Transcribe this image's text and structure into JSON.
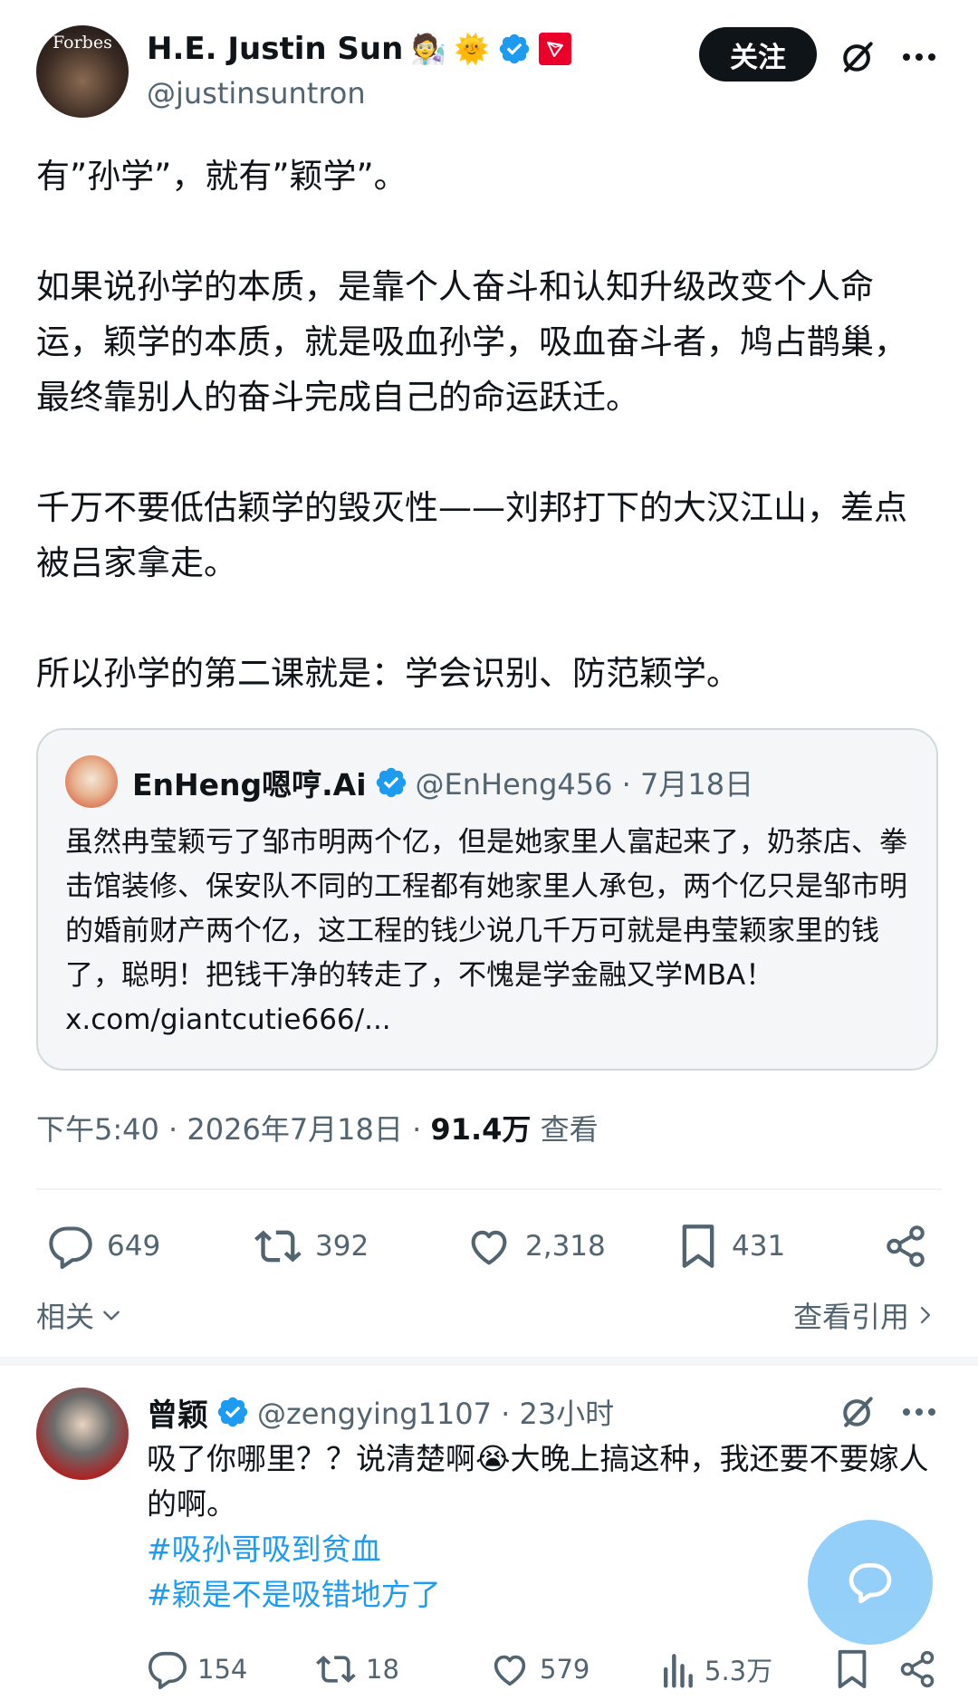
{
  "tweet": {
    "author_name": "H.E. Justin Sun",
    "author_handle": "@justinsuntron",
    "avatar_logo_text": "Forbes",
    "badge_emojis": [
      "🧑‍🔬",
      "🌞"
    ],
    "follow_label": "关注",
    "paragraphs": [
      "有”孙学”，就有”颖学”。",
      "如果说孙学的本质，是靠个人奋斗和认知升级改变个人命运，颖学的本质，就是吸血孙学，吸血奋斗者，鸠占鹊巢，最终靠别人的奋斗完成自己的命运跃迁。",
      "千万不要低估颖学的毁灭性——刘邦打下的大汉江山，差点被吕家拿走。",
      "所以孙学的第二课就是：学会识别、防范颖学。"
    ],
    "quote": {
      "author_name": "EnHeng嗯哼.Ai",
      "handle_time": "@EnHeng456 · 7月18日",
      "text": "虽然冉莹颖亏了邹市明两个亿，但是她家里人富起来了，奶茶店、拳击馆装修、保安队不同的工程都有她家里人承包，两个亿只是邹市明的婚前财产两个亿，这工程的钱少说几千万可就是冉莹颖家里的钱了，聪明！把钱干净的转走了，不愧是学金融又学MBA！ x.com/giantcutie666/..."
    },
    "meta": {
      "time": "下午5:40 · 2026年7月18日 · ",
      "views": "91.4万",
      "views_label": " 查看"
    },
    "actions": {
      "replies": "649",
      "retweets": "392",
      "likes": "2,318",
      "bookmarks": "431"
    },
    "related_label": "相关",
    "view_quotes_label": "查看引用"
  },
  "reply": {
    "author_name": "曾颖",
    "handle_time": "@zengying1107 · 23小时",
    "text": "吸了你哪里？？说清楚啊😭大晚上搞这种，我还要不要嫁人的啊。",
    "hashtags": [
      "#吸孙哥吸到贫血",
      "#颖是不是吸错地方了"
    ],
    "actions": {
      "replies": "154",
      "retweets": "18",
      "likes": "579",
      "views": "5.3万"
    }
  },
  "colors": {
    "verified": "#1d9bf0",
    "tron": "#eb0029",
    "hashtag": "#1d9bf0",
    "fab": "#8ecdf8"
  },
  "icons": [
    "grok-icon",
    "more-icon",
    "verified-badge-icon",
    "tron-logo-icon",
    "reply-icon",
    "retweet-icon",
    "like-icon",
    "bookmark-icon",
    "share-icon",
    "views-icon",
    "chevron-down-icon",
    "chevron-right-icon",
    "compose-chat-icon"
  ]
}
